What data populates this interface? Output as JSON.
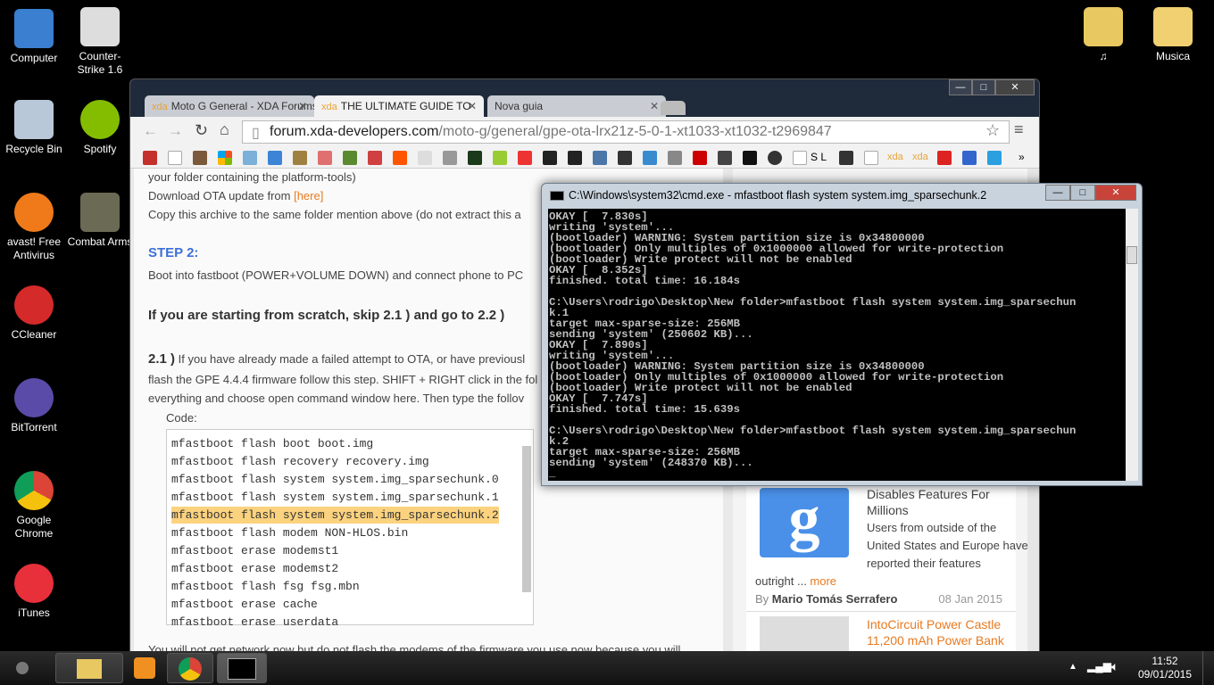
{
  "desktop": {
    "left": [
      {
        "label": "Computer"
      },
      {
        "label": "Recycle Bin"
      },
      {
        "label": "avast! Free Antivirus"
      },
      {
        "label": "CCleaner"
      },
      {
        "label": "BitTorrent"
      },
      {
        "label": "Google Chrome"
      },
      {
        "label": "iTunes"
      }
    ],
    "second": [
      {
        "label": "Counter-Strike 1.6"
      },
      {
        "label": "Spotify"
      },
      {
        "label": "Combat Arms"
      }
    ],
    "right": [
      {
        "label": "♫"
      },
      {
        "label": "Musica"
      }
    ]
  },
  "browser": {
    "tabs": [
      {
        "label": "Moto G General - XDA Forums",
        "favicon": "xda"
      },
      {
        "label": "THE ULTIMATE GUIDE TO",
        "favicon": "xda"
      },
      {
        "label": "Nova guia"
      }
    ],
    "url_host": "forum.xda-developers.com",
    "url_path": "/moto-g/general/gpe-ota-lrx21z-5-0-1-xt1033-xt1032-t2969847",
    "bookmarks_more": "»",
    "bookmark_text": [
      "S L",
      "xda",
      "xda"
    ],
    "article": {
      "line1": "your folder containing the platform-tools)",
      "dl_prefix": "Download OTA update from ",
      "dl_link": "[here]",
      "copy": "Copy this archive to the same folder mention above (do not extract this a",
      "step2": "STEP 2:",
      "step2_text": "Boot into fastboot (POWER+VOLUME DOWN) and connect phone to PC",
      "scratch": "If you are starting from scratch, skip 2.1 ) and go to 2.2 )",
      "s21_num": "2.1 )",
      "s21_a": "If you have already made a failed attempt to OTA, or have previousl",
      "s21_b": "flash the GPE 4.4.4 firmware follow this step. SHIFT + RIGHT click in the fol",
      "s21_c": "everything and choose open command window here. Then type the follov",
      "code_label": "Code:",
      "code": [
        "mfastboot flash boot boot.img",
        "mfastboot flash recovery recovery.img",
        "mfastboot flash system system.img_sparsechunk.0",
        "mfastboot flash system system.img_sparsechunk.1",
        "mfastboot flash system system.img_sparsechunk.2",
        "mfastboot flash modem NON-HLOS.bin",
        "mfastboot erase modemst1",
        "mfastboot erase modemst2",
        "mfastboot flash fsg fsg.mbn",
        "mfastboot erase cache",
        "mfastboot erase userdata"
      ],
      "highlighted_code_index": 4,
      "bottom": "You will not get network now but do not flash the modems of the firmware you use now because you will"
    },
    "sidebar": {
      "card1_title": "Disables Features For",
      "card1_title2": "Millions",
      "card1_desc": [
        "Users from outside of the",
        "United States and Europe have",
        "reported their features"
      ],
      "card1_more_prefix": "outright ... ",
      "card1_more": "more",
      "by": "By ",
      "author": "Mario Tomás Serrafero",
      "date": "08 Jan 2015",
      "card2_title": "IntoCircuit Power Castle",
      "card2_title2": "11,200 mAh Power Bank"
    }
  },
  "cmd": {
    "title": "C:\\Windows\\system32\\cmd.exe - mfastboot  flash system system.img_sparsechunk.2",
    "lines": [
      "OKAY [  7.830s]",
      "writing 'system'...",
      "(bootloader) WARNING: System partition size is 0x34800000",
      "(bootloader) Only multiples of 0x1000000 allowed for write-protection",
      "(bootloader) Write protect will not be enabled",
      "OKAY [  8.352s]",
      "finished. total time: 16.184s",
      "",
      "C:\\Users\\rodrigo\\Desktop\\New folder>mfastboot flash system system.img_sparsechun",
      "k.1",
      "target max-sparse-size: 256MB",
      "sending 'system' (250602 KB)...",
      "OKAY [  7.890s]",
      "writing 'system'...",
      "(bootloader) WARNING: System partition size is 0x34800000",
      "(bootloader) Only multiples of 0x1000000 allowed for write-protection",
      "(bootloader) Write protect will not be enabled",
      "OKAY [  7.747s]",
      "finished. total time: 15.639s",
      "",
      "C:\\Users\\rodrigo\\Desktop\\New folder>mfastboot flash system system.img_sparsechun",
      "k.2",
      "target max-sparse-size: 256MB",
      "sending 'system' (248370 KB)...",
      "_"
    ]
  },
  "taskbar": {
    "time": "11:52",
    "date": "09/01/2015"
  }
}
